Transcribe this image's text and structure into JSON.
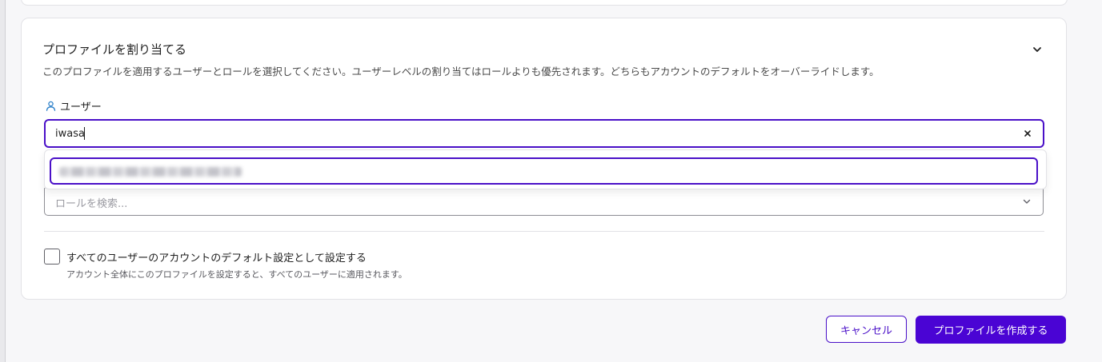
{
  "profile_section": {
    "title": "プロファイルを割り当てる",
    "description": "このプロファイルを適用するユーザーとロールを選択してください。ユーザーレベルの割り当てはロールよりも優先されます。どちらもアカウントのデフォルトをオーバーライドします。"
  },
  "users": {
    "label": "ユーザー",
    "icon": "user-icon",
    "search_value": "iwasa",
    "clear_icon": "close-icon"
  },
  "roles": {
    "placeholder": "ロールを検索...",
    "icon": "chevron-down-icon"
  },
  "default_setting": {
    "checkbox_checked": false,
    "label": "すべてのユーザーのアカウントのデフォルト設定として設定する",
    "help": "アカウント全体にこのプロファイルを設定すると、すべてのユーザーに適用されます。"
  },
  "actions": {
    "cancel_label": "キャンセル",
    "create_label": "プロファイルを作成する"
  },
  "colors": {
    "accent": "#4a04d4",
    "focus_border": "#4a10c8",
    "user_icon": "#2a7fc9"
  }
}
